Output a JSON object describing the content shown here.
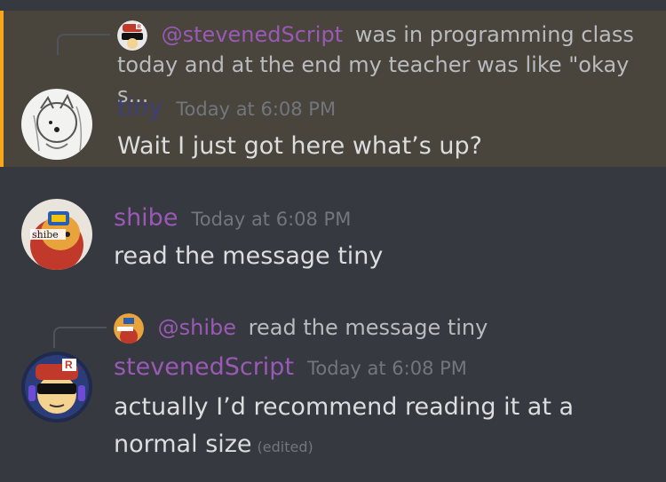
{
  "messages": [
    {
      "reply": {
        "mention": "@stevenedScript",
        "preview_line1": "was in programming class",
        "preview_line2": "today and at the end my teacher was like \"okay s..."
      },
      "author": "tiny",
      "timestamp": "Today at 6:08 PM",
      "text": "Wait I just got here what’s up?",
      "author_color": "#3b3f7a",
      "highlight_color": "#faa61a"
    },
    {
      "author": "shibe",
      "timestamp": "Today at 6:08 PM",
      "text": "read the message tiny",
      "author_color": "#9b59b6"
    },
    {
      "reply": {
        "mention": "@shibe",
        "preview_line1": "read the message tiny"
      },
      "author": "stevenedScript",
      "timestamp": "Today at 6:08 PM",
      "text_line1": "actually I’d recommend reading it at a",
      "text_line2": "normal size",
      "edited": "(edited)",
      "author_color": "#9b59b6"
    }
  ],
  "avatars": {
    "tiny": "sketch-avatar",
    "shibe": "doge-avatar",
    "stevenedScript": "roblox-avatar",
    "shibe_badge_text": "shibe"
  }
}
